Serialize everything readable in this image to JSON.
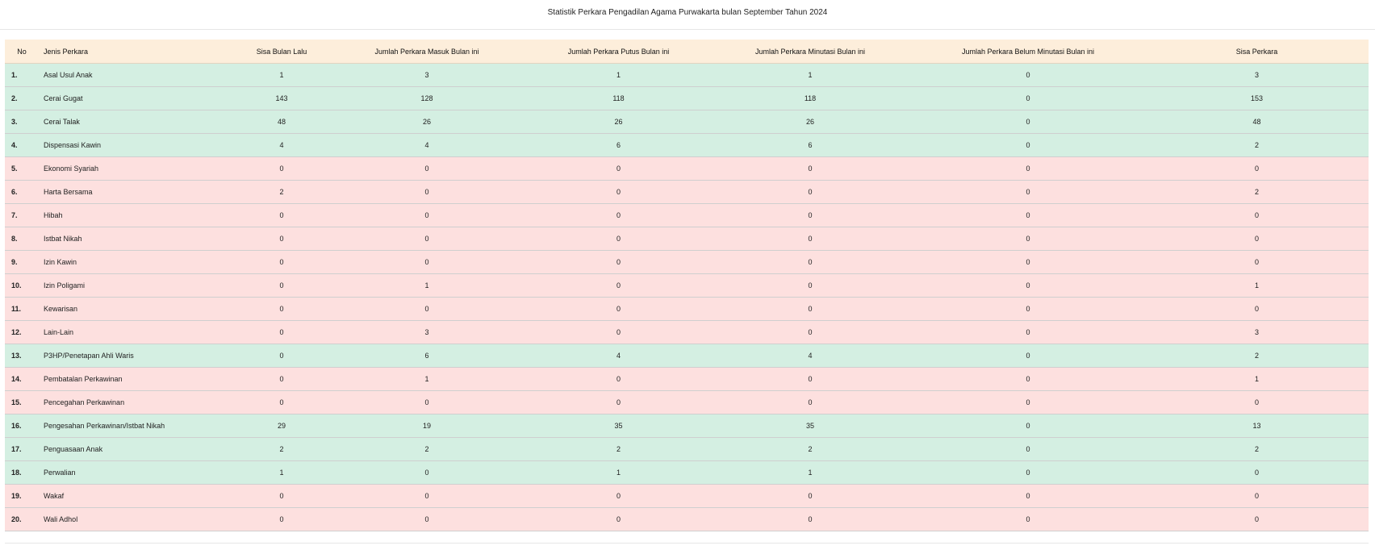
{
  "page": {
    "title": "Statistik Perkara Pengadilan Agama Purwakarta bulan September Tahun 2024"
  },
  "table": {
    "headers": {
      "no": "No",
      "jenis": "Jenis Perkara",
      "sisa_lalu": "Sisa Bulan Lalu",
      "masuk": "Jumlah Perkara Masuk Bulan ini",
      "putus": "Jumlah Perkara Putus Bulan ini",
      "minutasi": "Jumlah Perkara Minutasi Bulan ini",
      "belum_minutasi": "Jumlah Perkara Belum Minutasi Bulan ini",
      "sisa": "Sisa Perkara"
    },
    "colors": {
      "header": "#fdeedb",
      "green": "#d4efe2",
      "red": "#fde0df"
    },
    "rows": [
      {
        "no": "1.",
        "jenis": "Asal Usul Anak",
        "sisa_lalu": "1",
        "masuk": "3",
        "putus": "1",
        "minutasi": "1",
        "belum_minutasi": "0",
        "sisa": "3",
        "status": "green"
      },
      {
        "no": "2.",
        "jenis": "Cerai Gugat",
        "sisa_lalu": "143",
        "masuk": "128",
        "putus": "118",
        "minutasi": "118",
        "belum_minutasi": "0",
        "sisa": "153",
        "status": "green"
      },
      {
        "no": "3.",
        "jenis": "Cerai Talak",
        "sisa_lalu": "48",
        "masuk": "26",
        "putus": "26",
        "minutasi": "26",
        "belum_minutasi": "0",
        "sisa": "48",
        "status": "green"
      },
      {
        "no": "4.",
        "jenis": "Dispensasi Kawin",
        "sisa_lalu": "4",
        "masuk": "4",
        "putus": "6",
        "minutasi": "6",
        "belum_minutasi": "0",
        "sisa": "2",
        "status": "green"
      },
      {
        "no": "5.",
        "jenis": "Ekonomi Syariah",
        "sisa_lalu": "0",
        "masuk": "0",
        "putus": "0",
        "minutasi": "0",
        "belum_minutasi": "0",
        "sisa": "0",
        "status": "red"
      },
      {
        "no": "6.",
        "jenis": "Harta Bersama",
        "sisa_lalu": "2",
        "masuk": "0",
        "putus": "0",
        "minutasi": "0",
        "belum_minutasi": "0",
        "sisa": "2",
        "status": "red"
      },
      {
        "no": "7.",
        "jenis": "Hibah",
        "sisa_lalu": "0",
        "masuk": "0",
        "putus": "0",
        "minutasi": "0",
        "belum_minutasi": "0",
        "sisa": "0",
        "status": "red"
      },
      {
        "no": "8.",
        "jenis": "Istbat Nikah",
        "sisa_lalu": "0",
        "masuk": "0",
        "putus": "0",
        "minutasi": "0",
        "belum_minutasi": "0",
        "sisa": "0",
        "status": "red"
      },
      {
        "no": "9.",
        "jenis": "Izin Kawin",
        "sisa_lalu": "0",
        "masuk": "0",
        "putus": "0",
        "minutasi": "0",
        "belum_minutasi": "0",
        "sisa": "0",
        "status": "red"
      },
      {
        "no": "10.",
        "jenis": "Izin Poligami",
        "sisa_lalu": "0",
        "masuk": "1",
        "putus": "0",
        "minutasi": "0",
        "belum_minutasi": "0",
        "sisa": "1",
        "status": "red"
      },
      {
        "no": "11.",
        "jenis": "Kewarisan",
        "sisa_lalu": "0",
        "masuk": "0",
        "putus": "0",
        "minutasi": "0",
        "belum_minutasi": "0",
        "sisa": "0",
        "status": "red"
      },
      {
        "no": "12.",
        "jenis": "Lain-Lain",
        "sisa_lalu": "0",
        "masuk": "3",
        "putus": "0",
        "minutasi": "0",
        "belum_minutasi": "0",
        "sisa": "3",
        "status": "red"
      },
      {
        "no": "13.",
        "jenis": "P3HP/Penetapan Ahli Waris",
        "sisa_lalu": "0",
        "masuk": "6",
        "putus": "4",
        "minutasi": "4",
        "belum_minutasi": "0",
        "sisa": "2",
        "status": "green"
      },
      {
        "no": "14.",
        "jenis": "Pembatalan Perkawinan",
        "sisa_lalu": "0",
        "masuk": "1",
        "putus": "0",
        "minutasi": "0",
        "belum_minutasi": "0",
        "sisa": "1",
        "status": "red"
      },
      {
        "no": "15.",
        "jenis": "Pencegahan Perkawinan",
        "sisa_lalu": "0",
        "masuk": "0",
        "putus": "0",
        "minutasi": "0",
        "belum_minutasi": "0",
        "sisa": "0",
        "status": "red"
      },
      {
        "no": "16.",
        "jenis": "Pengesahan Perkawinan/Istbat Nikah",
        "sisa_lalu": "29",
        "masuk": "19",
        "putus": "35",
        "minutasi": "35",
        "belum_minutasi": "0",
        "sisa": "13",
        "status": "green"
      },
      {
        "no": "17.",
        "jenis": "Penguasaan Anak",
        "sisa_lalu": "2",
        "masuk": "2",
        "putus": "2",
        "minutasi": "2",
        "belum_minutasi": "0",
        "sisa": "2",
        "status": "green"
      },
      {
        "no": "18.",
        "jenis": "Perwalian",
        "sisa_lalu": "1",
        "masuk": "0",
        "putus": "1",
        "minutasi": "1",
        "belum_minutasi": "0",
        "sisa": "0",
        "status": "green"
      },
      {
        "no": "19.",
        "jenis": "Wakaf",
        "sisa_lalu": "0",
        "masuk": "0",
        "putus": "0",
        "minutasi": "0",
        "belum_minutasi": "0",
        "sisa": "0",
        "status": "red"
      },
      {
        "no": "20.",
        "jenis": "Wali Adhol",
        "sisa_lalu": "0",
        "masuk": "0",
        "putus": "0",
        "minutasi": "0",
        "belum_minutasi": "0",
        "sisa": "0",
        "status": "red"
      }
    ]
  }
}
